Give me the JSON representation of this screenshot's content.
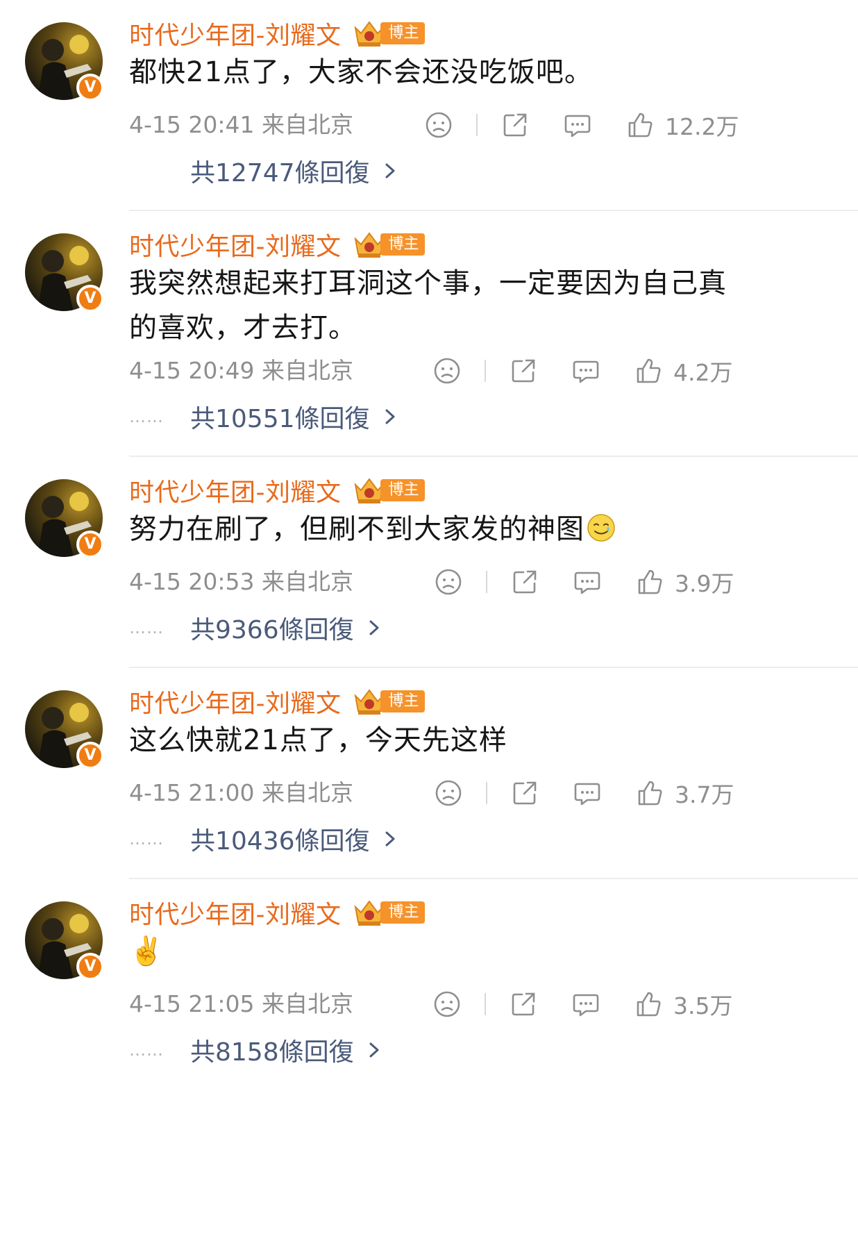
{
  "colors": {
    "username": "#e86a1c",
    "badge": "#f6922a",
    "verified": "#f07d12",
    "reply_link": "#4a5a7a",
    "meta": "#8e8e8e"
  },
  "comments": [
    {
      "username": "时代少年团-刘耀文",
      "badge": "博主",
      "verified_mark": "V",
      "text": "都快21点了，大家不会还没吃饭吧。",
      "timestamp": "4-15 20:41 来自北京",
      "likes": "12.2万",
      "replies": "共12747條回復",
      "dots": ""
    },
    {
      "username": "时代少年团-刘耀文",
      "badge": "博主",
      "verified_mark": "V",
      "text": "我突然想起来打耳洞这个事，一定要因为自己真的喜欢，才去打。",
      "timestamp": "4-15 20:49 来自北京",
      "likes": "4.2万",
      "replies": "共10551條回復",
      "dots": "……"
    },
    {
      "username": "时代少年团-刘耀文",
      "badge": "博主",
      "verified_mark": "V",
      "text": "努力在刷了，但刷不到大家发的神图",
      "text_emoji": "smiling-face-with-tear",
      "timestamp": "4-15 20:53 来自北京",
      "likes": "3.9万",
      "replies": "共9366條回復",
      "dots": "……"
    },
    {
      "username": "时代少年团-刘耀文",
      "badge": "博主",
      "verified_mark": "V",
      "text": "这么快就21点了，今天先这样",
      "timestamp": "4-15 21:00 来自北京",
      "likes": "3.7万",
      "replies": "共10436條回復",
      "dots": "……"
    },
    {
      "username": "时代少年团-刘耀文",
      "badge": "博主",
      "verified_mark": "V",
      "text": "✌️",
      "timestamp": "4-15 21:05 来自北京",
      "likes": "3.5万",
      "replies": "共8158條回復",
      "dots": "……"
    }
  ]
}
